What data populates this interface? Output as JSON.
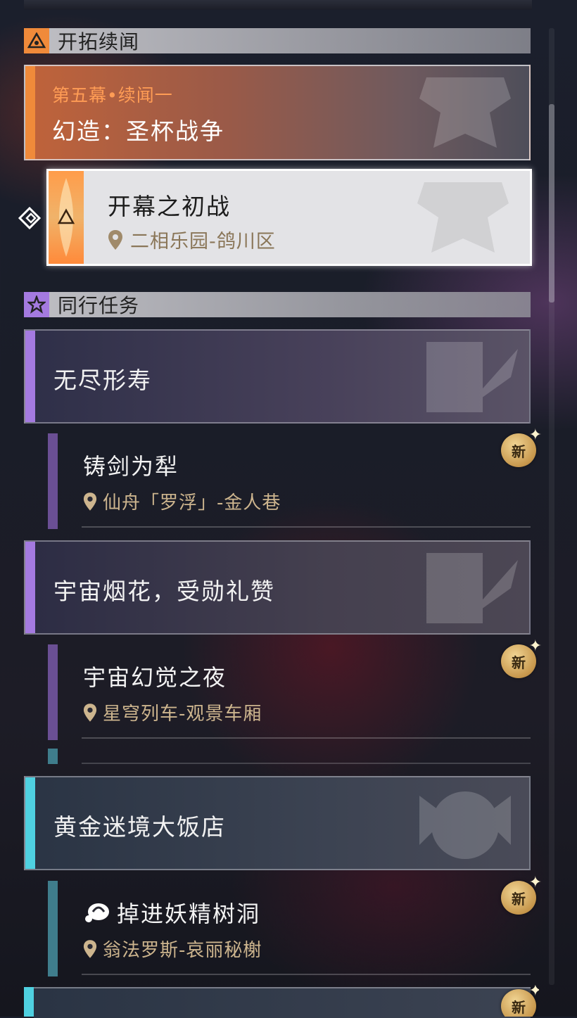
{
  "sections": {
    "trailblaze": {
      "title": "开拓续闻"
    },
    "companion": {
      "title": "同行任务"
    }
  },
  "main_story": {
    "chapter": "第五幕•续闻一",
    "title": "幻造：圣杯战争",
    "selected_quest": {
      "title": "开幕之初战",
      "location": "二相乐园-鸽川区"
    }
  },
  "companion_missions": [
    {
      "title": "无尽形寿",
      "quest": {
        "title": "铸剑为犁",
        "location": "仙舟「罗浮」-金人巷",
        "badge": "新"
      }
    },
    {
      "title": "宇宙烟花，受勋礼赞",
      "quest": {
        "title": "宇宙幻觉之夜",
        "location": "星穹列车-观景车厢",
        "badge": "新"
      }
    },
    {
      "title": "黄金迷境大饭店",
      "quest": {
        "title": "掉进妖精树洞",
        "location": "翁法罗斯-哀丽秘榭",
        "badge": "新"
      }
    }
  ],
  "partial_badge": "新",
  "colors": {
    "trailblaze_accent": "#f08a3a",
    "companion_purple": "#a47ae0",
    "companion_cyan": "#4fd0e0",
    "location_text": "#cdb58e"
  },
  "icons": {
    "trailblaze": "triangle-eye-icon",
    "companion": "star-icon",
    "location": "map-pin-icon",
    "selection": "diamond-arrow-icon",
    "quest_type": "dream-bubble-icon"
  }
}
